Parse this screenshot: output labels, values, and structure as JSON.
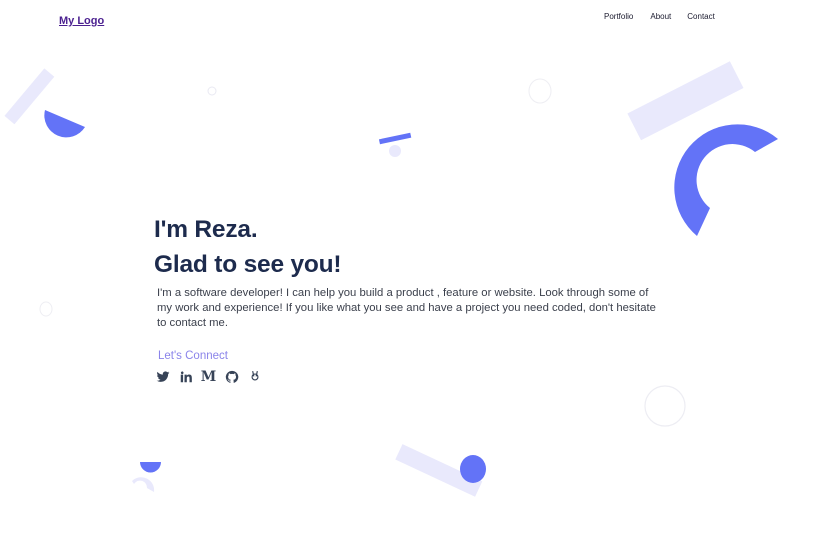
{
  "header": {
    "logo": "My Logo",
    "nav": [
      "Portfolio",
      "About",
      "Contact"
    ]
  },
  "hero": {
    "line1": "I'm Reza.",
    "line2": "Glad to see you!",
    "description": "I'm a software developer! I can help you build a product , feature or website. Look through some of my work and experience! If you like what you see and have a project you need coded, don't hesitate to contact me.",
    "connect": "Let's Connect"
  },
  "socials": [
    "twitter-icon",
    "linkedin-icon",
    "medium-icon",
    "github-icon",
    "hackerrank-icon"
  ],
  "colors": {
    "accent": "#6373f7",
    "accent_light": "#e9e9fc",
    "heading": "#1d2b4d",
    "link": "#8b84ea"
  }
}
